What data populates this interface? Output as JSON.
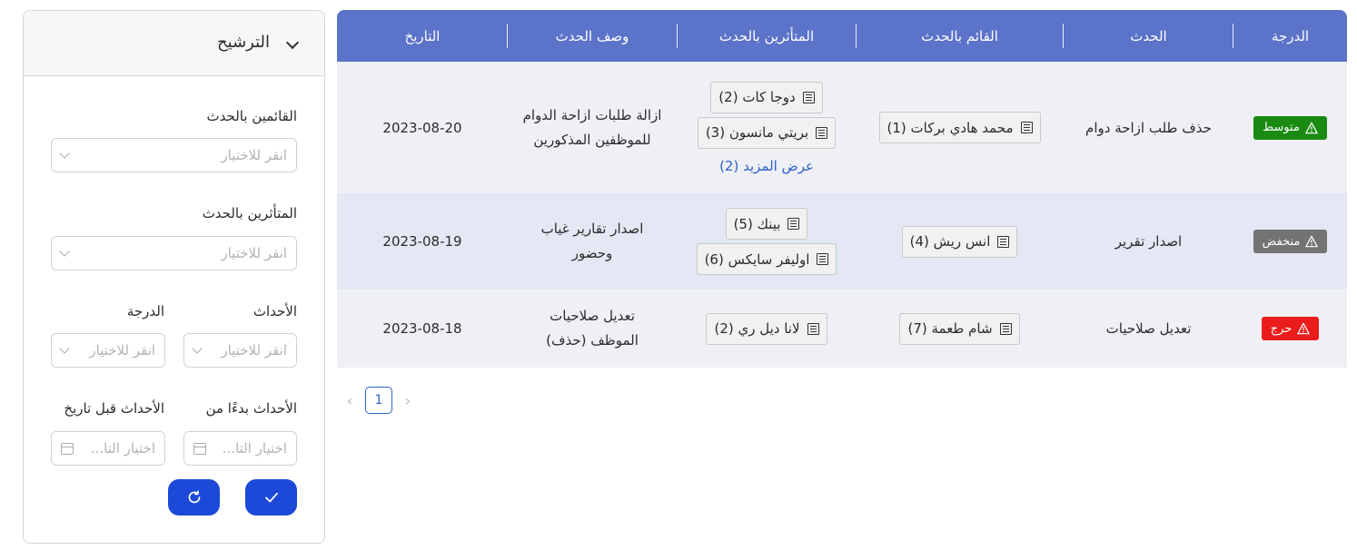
{
  "table": {
    "headers": {
      "grade": "الدرجة",
      "event": "الحدث",
      "actor": "القائم بالحدث",
      "affected": "المتأثرين بالحدث",
      "description": "وصف الحدث",
      "date": "التاريخ"
    },
    "rows": [
      {
        "grade": "متوسط",
        "grade_color": "#1a8a12",
        "event": "حذف طلب ازاحة دوام",
        "actor": "محمد هادي بركات (1)",
        "affected": [
          "دوجا كات (2)",
          "بريتي مانسون (3)"
        ],
        "more": "عرض المزيد (2)",
        "description_line1": "ازالة طلبات ازاحة الدوام",
        "description_line2": "للموظفين المذكورين",
        "date": "2023-08-20"
      },
      {
        "grade": "منخفض",
        "grade_color": "#737373",
        "event": "اصدار تقرير",
        "actor": "انس ريش (4)",
        "affected": [
          "بينك (5)",
          "اوليفر سايكس (6)"
        ],
        "description_line1": "اصدار تقارير غياب",
        "description_line2": "وحضور",
        "date": "2023-08-19"
      },
      {
        "grade": "حرج",
        "grade_color": "#ea1c1c",
        "event": "تعديل صلاحيات",
        "actor": "شام طعمة (7)",
        "affected": [
          "لانا ديل ري (2)"
        ],
        "description_line1": "تعديل صلاحيات",
        "description_line2": "الموظف (حذف)",
        "date": "2023-08-18"
      }
    ]
  },
  "pagination": {
    "current_page": "1"
  },
  "filter": {
    "title": "الترشيح",
    "actors_label": "القائمين بالحدث",
    "actors_placeholder": "انقر للاختيار",
    "affected_label": "المتأثرين بالحدث",
    "affected_placeholder": "انقر للاختيار",
    "events_label": "الأحداث",
    "events_placeholder": "انقر للاختيار",
    "grade_label": "الدرجة",
    "grade_placeholder": "انقر للاختيار",
    "from_label": "الأحداث بدءًا من",
    "from_placeholder": "اختيار التا...",
    "before_label": "الأحداث قبل تاريخ",
    "before_placeholder": "اختيار التا..."
  },
  "colors": {
    "header_bg": "#5b73c8",
    "row_alt_bg": "#e3e8f4",
    "row_bg": "#eef0f5",
    "primary_button": "#1d49d8",
    "link": "#2f62c9"
  },
  "icons": {
    "grade_badge": "warning-triangle-icon",
    "person_chip": "document-list-icon",
    "apply": "check-icon",
    "reset": "refresh-icon",
    "date": "calendar-icon",
    "dropdown": "chevron-down-icon"
  }
}
